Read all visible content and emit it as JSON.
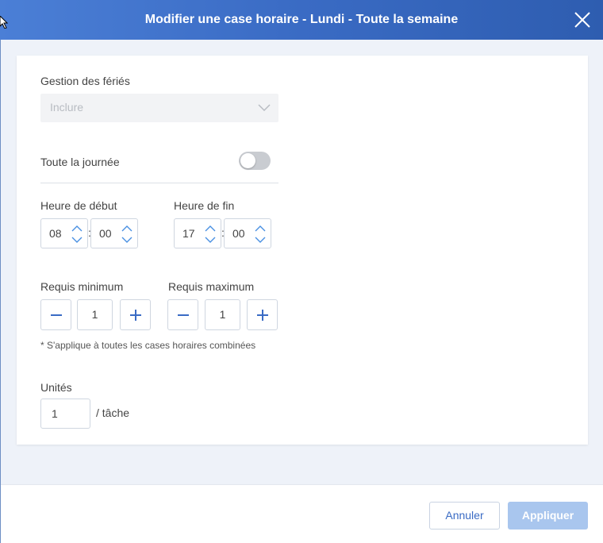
{
  "dialog": {
    "title": "Modifier une case horaire - Lundi - Toute la semaine"
  },
  "holidays": {
    "label": "Gestion des fériés",
    "selected": "Inclure"
  },
  "all_day": {
    "label": "Toute la journée",
    "enabled": false
  },
  "start_time": {
    "label": "Heure de début",
    "hour": "08",
    "minute": "00",
    "separator": ":"
  },
  "end_time": {
    "label": "Heure de fin",
    "hour": "17",
    "minute": "00",
    "separator": ":"
  },
  "min_required": {
    "label": "Requis minimum",
    "value": "1"
  },
  "max_required": {
    "label": "Requis maximum",
    "value": "1"
  },
  "note": "* S'applique à toutes les cases horaires combinées",
  "units": {
    "label": "Unités",
    "value": "1",
    "suffix": "/ tâche"
  },
  "footer": {
    "cancel_label": "Annuler",
    "apply_label": "Appliquer"
  },
  "colors": {
    "header_start": "#4b7fd6",
    "header_end": "#2e5db0",
    "accent": "#3a6bc4",
    "apply_disabled": "#a9c6ee"
  }
}
